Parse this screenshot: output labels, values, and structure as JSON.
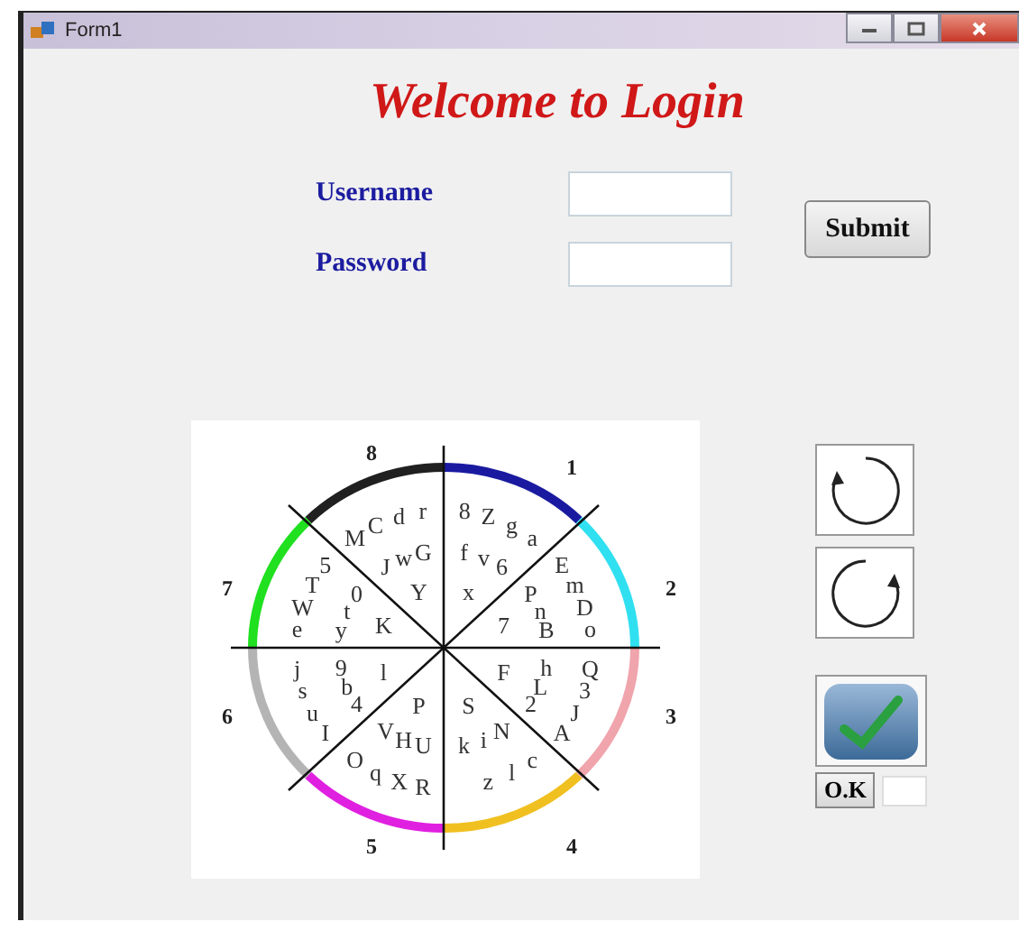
{
  "window": {
    "title": "Form1"
  },
  "heading": "Welcome to Login",
  "fields": [
    {
      "label": "Username"
    },
    {
      "label": "Password"
    }
  ],
  "submit": "Submit",
  "wheel": {
    "sectors": [
      {
        "number": "8",
        "color": "#202020",
        "letters": [
          "d",
          "r",
          "C",
          "M",
          "w",
          "G",
          "J",
          "Y"
        ]
      },
      {
        "number": "1",
        "color": "#1a1aa0",
        "letters": [
          "8",
          "Z",
          "g",
          "a",
          "f",
          "v",
          "6",
          "x"
        ]
      },
      {
        "number": "7",
        "color": "#20e020",
        "letters": [
          "5",
          "T",
          "0",
          "W",
          "t",
          "e",
          "y",
          "K"
        ]
      },
      {
        "number": "2",
        "color": "#30e0f0",
        "letters": [
          "E",
          "m",
          "P",
          "n",
          "D",
          "7",
          "B",
          "o"
        ]
      },
      {
        "number": "6",
        "color": "#b4b4b4",
        "letters": [
          "j",
          "9",
          "l",
          "s",
          "b",
          "4",
          "u",
          "I"
        ]
      },
      {
        "number": "3",
        "color": "#f0a4ac",
        "letters": [
          "F",
          "h",
          "Q",
          "L",
          "3",
          "2",
          "J",
          "A"
        ]
      },
      {
        "number": "5",
        "color": "#e020e0",
        "letters": [
          "P",
          "V",
          "H",
          "U",
          "O",
          "q",
          "X",
          "R"
        ]
      },
      {
        "number": "4",
        "color": "#f0c020",
        "letters": [
          "S",
          "N",
          "k",
          "i",
          "c",
          "l",
          "z"
        ]
      }
    ]
  },
  "ok_button": "O.K"
}
